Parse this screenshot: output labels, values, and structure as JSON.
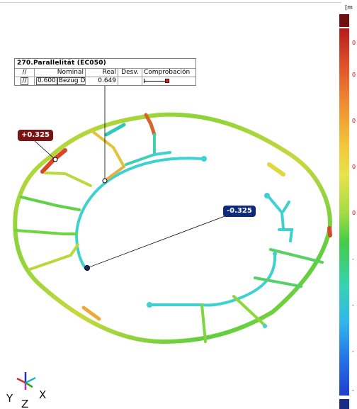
{
  "feature_table": {
    "title": "270.Parallelität (EC050)",
    "header": {
      "symbol": "//",
      "nominal": "Nominal",
      "real": "Real",
      "desv": "Desv.",
      "comprobacion": "Comprobación"
    },
    "row": {
      "symbol": "//",
      "nominal": "0.600",
      "datum": "Bezug D",
      "real": "0.649",
      "desv": "",
      "status_color": "#d42020"
    }
  },
  "flags": {
    "max_deviation": "+0.325",
    "min_deviation": "-0.325"
  },
  "legend": {
    "unit": "[m",
    "top_color": "#6e1010",
    "bottom_color": "#1a2c86",
    "tick_marks": [
      "0",
      "0",
      "0",
      "0",
      "0",
      "0",
      "-",
      "-",
      "-",
      "-",
      "-"
    ]
  },
  "axes_triad": {
    "y_label": "Y",
    "z_label": "Z",
    "x_label": "X"
  }
}
